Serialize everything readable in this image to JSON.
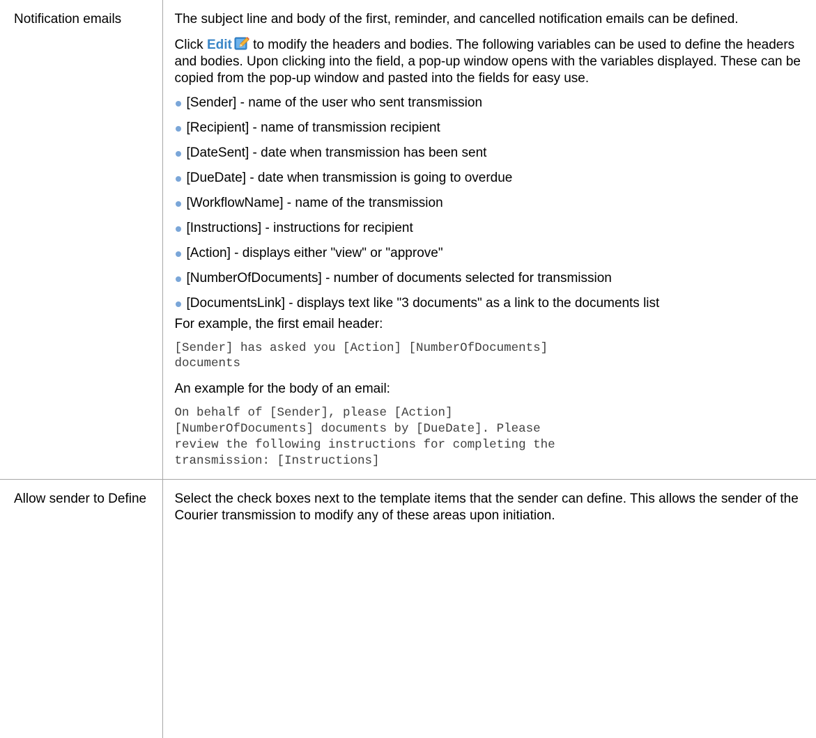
{
  "rows": [
    {
      "label": "Notification emails",
      "intro": "The subject line and body of the first, reminder, and cancelled notification emails can be defined.",
      "click_prefix": "Click ",
      "edit_link": "Edit",
      "click_suffix": " to modify the headers and bodies. The following variables can be used to define the headers and bodies. Upon clicking into the field, a pop-up window opens with the variables displayed. These can be copied from the pop-up window and pasted into the fields for easy use.",
      "edit_icon": "edit-pencil-icon",
      "variables": [
        "[Sender] - name of the user who sent transmission",
        "[Recipient] - name of transmission recipient",
        "[DateSent] - date when transmission has been sent",
        "[DueDate] - date when transmission is going to overdue",
        "[WorkflowName] - name of the transmission",
        "[Instructions] - instructions for recipient",
        "[Action] - displays either \"view\" or \"approve\"",
        "[NumberOfDocuments] - number of documents selected for transmission",
        "[DocumentsLink] - displays text like \"3 documents\" as a link to the documents list"
      ],
      "header_example_intro": "For example, the first email header:",
      "header_example_code": "[Sender] has asked you [Action] [NumberOfDocuments]\ndocuments",
      "body_example_intro": "An example for the body of an email:",
      "body_example_code": "On behalf of [Sender], please [Action]\n[NumberOfDocuments] documents by [DueDate]. Please\nreview the following instructions for completing the\ntransmission: [Instructions]"
    },
    {
      "label": "Allow sender to Define",
      "text": "Select the check boxes next to the template items that the sender can define. This allows the sender of the Courier transmission to modify any of these areas upon initiation."
    }
  ],
  "colors": {
    "border": "#a6a6a6",
    "link": "#3b86c7",
    "bullet": "#7aa6d8",
    "code_text": "#404040"
  }
}
